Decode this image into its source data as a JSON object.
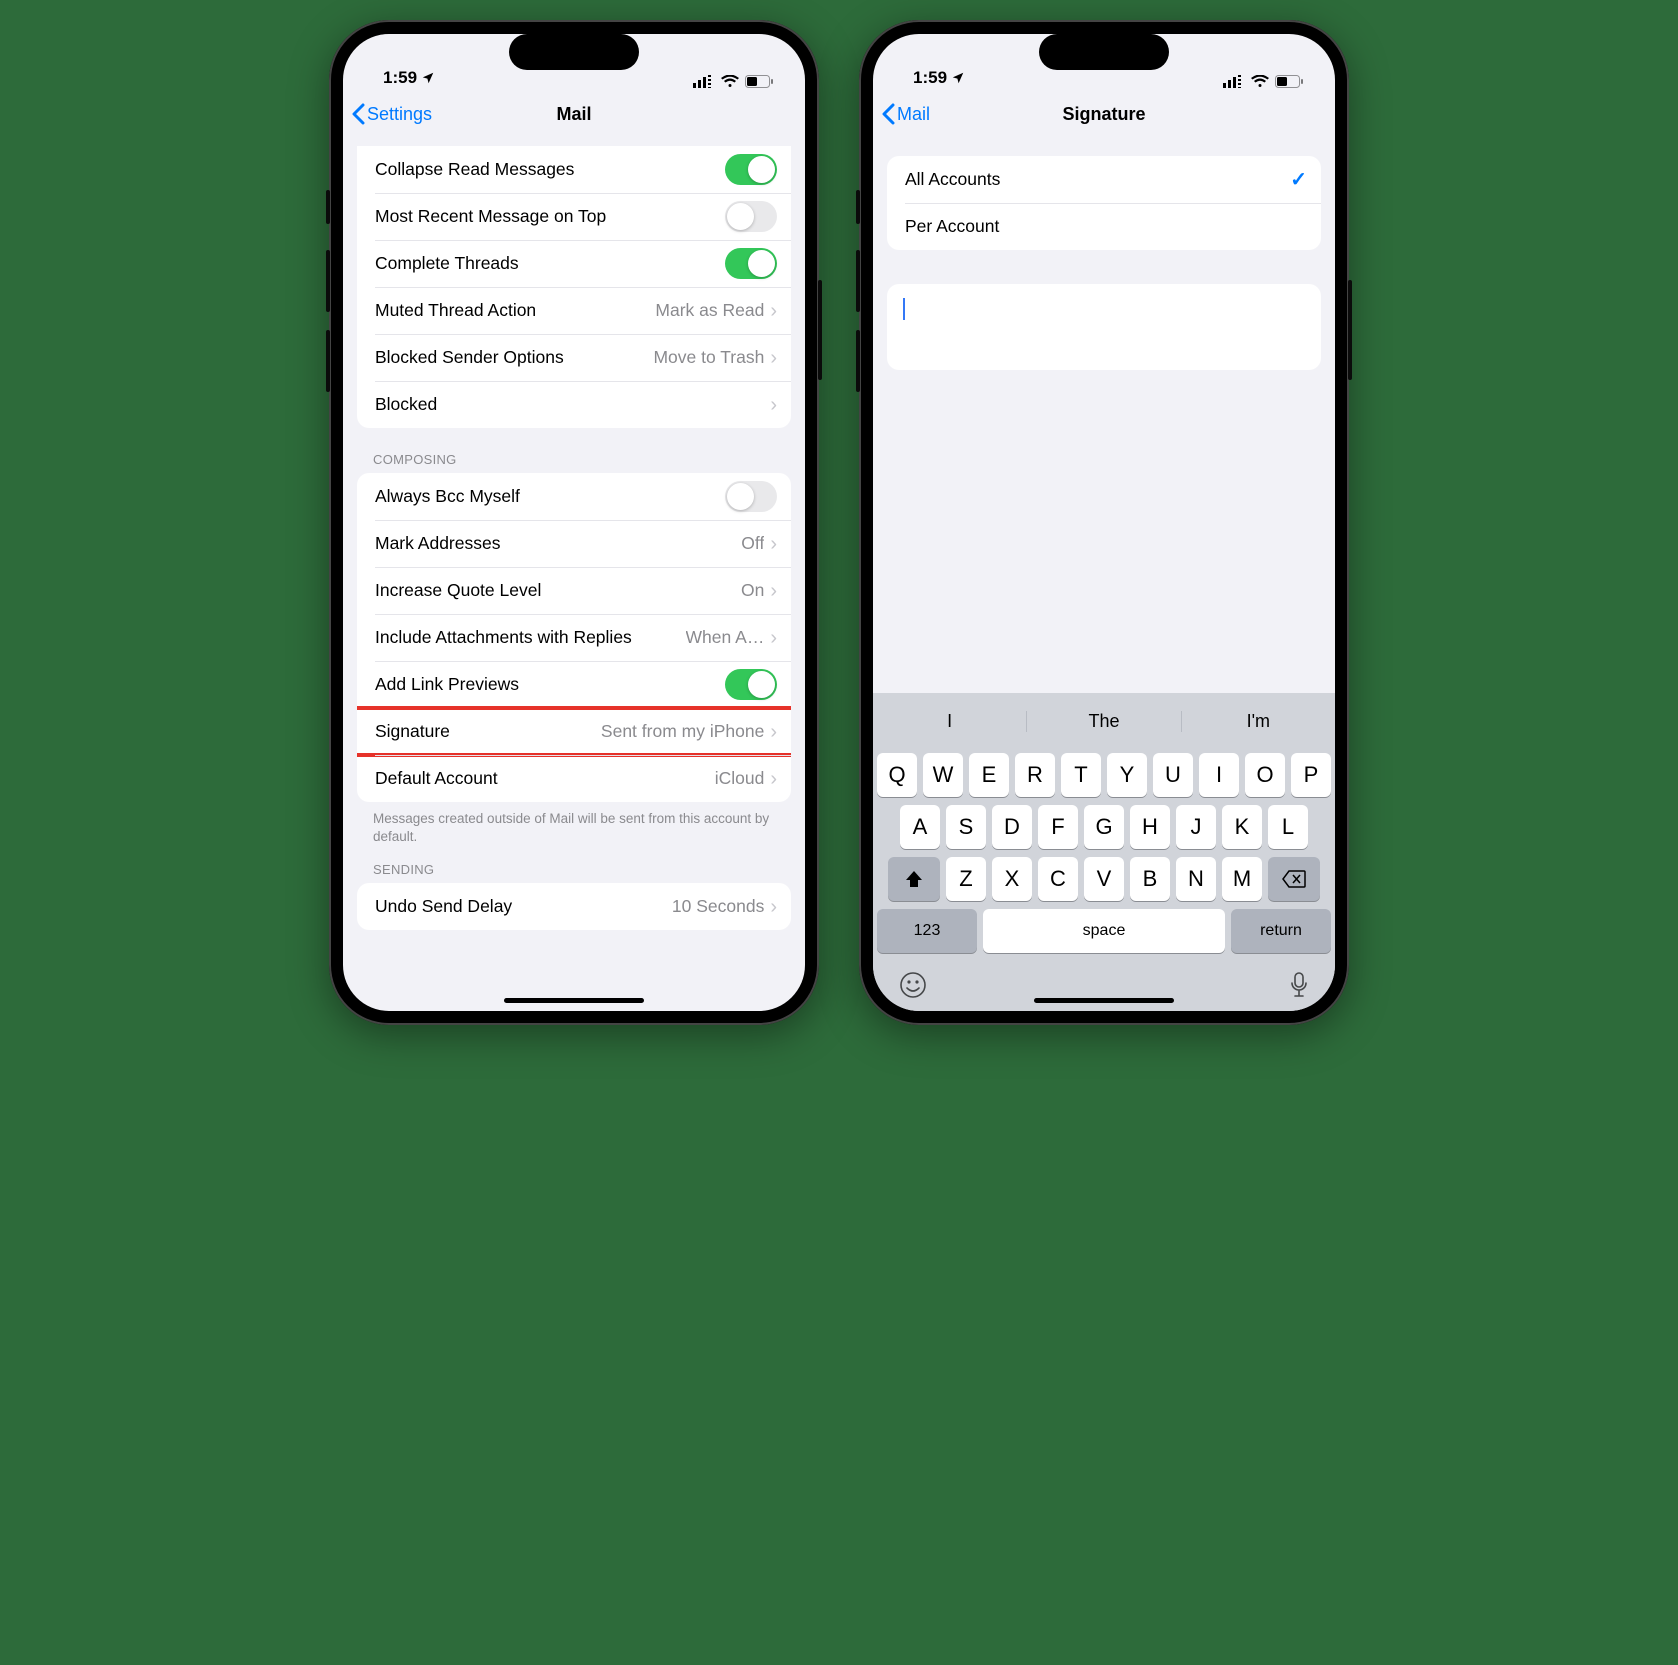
{
  "status": {
    "time": "1:59"
  },
  "left": {
    "back": "Settings",
    "title": "Mail",
    "rows_threading": {
      "collapse": "Collapse Read Messages",
      "recent_top": "Most Recent Message on Top",
      "complete": "Complete Threads",
      "muted_action": "Muted Thread Action",
      "muted_value": "Mark as Read",
      "blocked_options": "Blocked Sender Options",
      "blocked_value": "Move to Trash",
      "blocked": "Blocked"
    },
    "composing_header": "COMPOSING",
    "composing": {
      "bcc": "Always Bcc Myself",
      "mark_addr": "Mark Addresses",
      "mark_addr_val": "Off",
      "quote": "Increase Quote Level",
      "quote_val": "On",
      "attach": "Include Attachments with Replies",
      "attach_val": "When A…",
      "link_prev": "Add Link Previews",
      "signature": "Signature",
      "signature_val": "Sent from my iPhone",
      "default_acct": "Default Account",
      "default_acct_val": "iCloud"
    },
    "footer": "Messages created outside of Mail will be sent from this account by default.",
    "sending_header": "SENDING",
    "sending": {
      "undo": "Undo Send Delay",
      "undo_val": "10 Seconds"
    }
  },
  "right": {
    "back": "Mail",
    "title": "Signature",
    "all": "All Accounts",
    "per": "Per Account",
    "sugg": {
      "a": "I",
      "b": "The",
      "c": "I'm"
    },
    "keys": {
      "row1": [
        "Q",
        "W",
        "E",
        "R",
        "T",
        "Y",
        "U",
        "I",
        "O",
        "P"
      ],
      "row2": [
        "A",
        "S",
        "D",
        "F",
        "G",
        "H",
        "J",
        "K",
        "L"
      ],
      "row3": [
        "Z",
        "X",
        "C",
        "V",
        "B",
        "N",
        "M"
      ],
      "num": "123",
      "space": "space",
      "return": "return"
    }
  }
}
